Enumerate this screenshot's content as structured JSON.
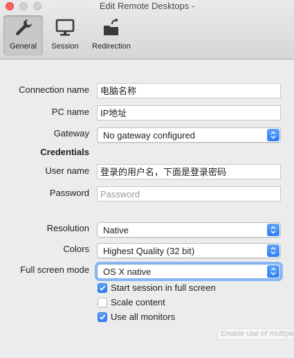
{
  "window": {
    "title": "Edit Remote Desktops -"
  },
  "tabs": [
    {
      "label": "General",
      "icon": "wrench-icon"
    },
    {
      "label": "Session",
      "icon": "monitor-icon"
    },
    {
      "label": "Redirection",
      "icon": "folder-export-icon"
    }
  ],
  "form": {
    "connection_name": {
      "label": "Connection name",
      "value": "电脑名称"
    },
    "pc_name": {
      "label": "PC name",
      "value": "IP地址"
    },
    "gateway": {
      "label": "Gateway",
      "value": "No gateway configured"
    },
    "credentials_heading": "Credentials",
    "user_name": {
      "label": "User name",
      "value": "登录的用户名，下面是登录密码"
    },
    "password": {
      "label": "Password",
      "placeholder": "Password"
    },
    "resolution": {
      "label": "Resolution",
      "value": "Native"
    },
    "colors": {
      "label": "Colors",
      "value": "Highest Quality (32 bit)"
    },
    "full_screen_mode": {
      "label": "Full screen mode",
      "value": "OS X native"
    },
    "checkboxes": [
      {
        "label": "Start session in full screen",
        "checked": true
      },
      {
        "label": "Scale content",
        "checked": false
      },
      {
        "label": "Use all monitors",
        "checked": true
      }
    ]
  },
  "tooltip": {
    "text": "Enable use of multiple"
  },
  "colors": {
    "accent": "#2d7ff4",
    "close": "#fc605c"
  }
}
